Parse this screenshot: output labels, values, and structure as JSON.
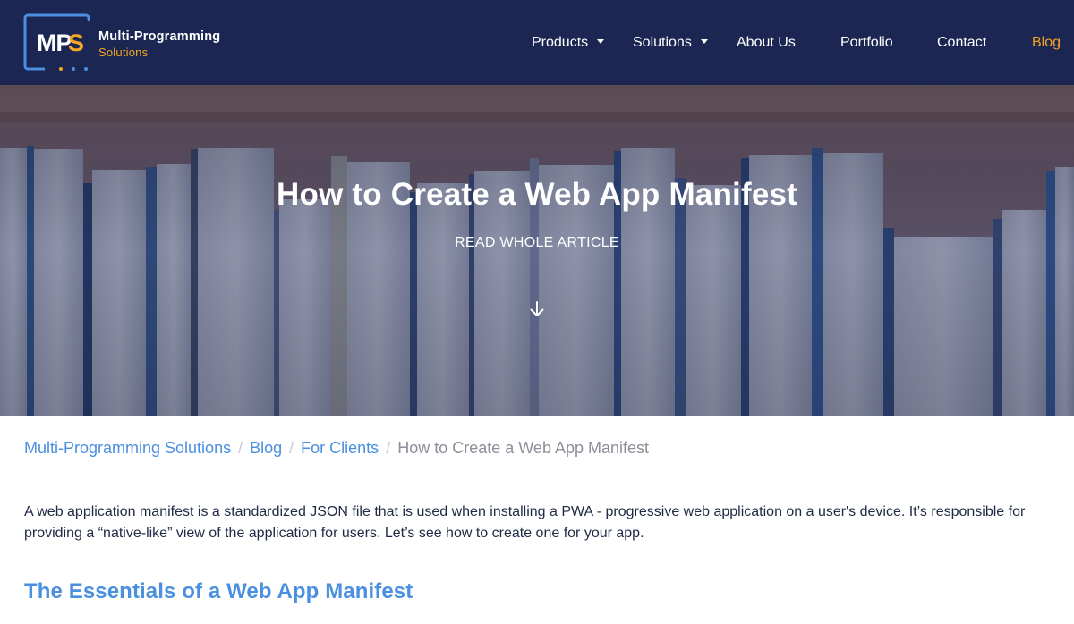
{
  "header": {
    "brand": {
      "name": "Multi-Programming",
      "sub": "Solutions",
      "mark": "MPS"
    },
    "nav": [
      {
        "label": "Products",
        "dropdown": true
      },
      {
        "label": "Solutions",
        "dropdown": true
      },
      {
        "label": "About Us",
        "dropdown": false
      },
      {
        "label": "Portfolio",
        "dropdown": false
      },
      {
        "label": "Contact",
        "dropdown": false
      },
      {
        "label": "Blog",
        "dropdown": false,
        "active": true
      }
    ]
  },
  "hero": {
    "title": "How to Create a Web App Manifest",
    "cta": "READ WHOLE ARTICLE",
    "arrow_icon": "arrow-down-icon"
  },
  "breadcrumb": {
    "items": [
      "Multi-Programming Solutions",
      "Blog",
      "For Clients"
    ],
    "current": "How to Create a Web App Manifest"
  },
  "article": {
    "intro": "A web application manifest is a standardized JSON file that is used when installing a PWA - progressive web application on a user's device. It’s responsible for providing a “native-like” view of the application for users. Let’s see how to create one for your app.",
    "heading": "The Essentials of a Web App Manifest"
  },
  "colors": {
    "header_bg": "#1b2653",
    "accent_orange": "#f5a623",
    "link_blue": "#4a8fe0",
    "body_text": "#1f2a44",
    "breadcrumb_current": "#8b8f98"
  }
}
